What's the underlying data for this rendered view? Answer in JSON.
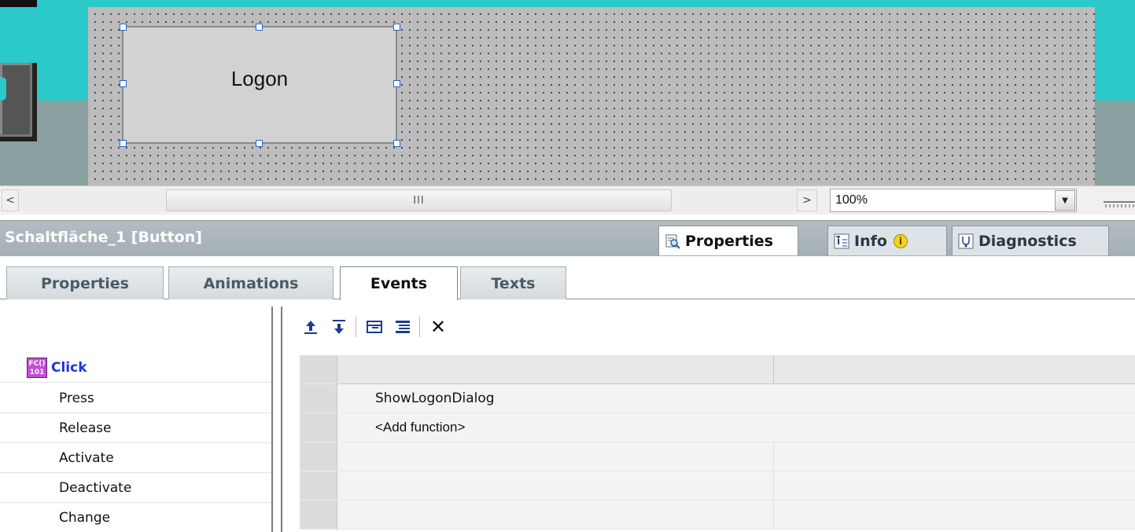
{
  "canvas": {
    "button_text": "Logon"
  },
  "scrollbar": {
    "left_arrow": "<",
    "grip": "III",
    "right_arrow": ">"
  },
  "zoom": {
    "value": "100%",
    "dropdown_arrow": "▼"
  },
  "inspector": {
    "object_title": "Schaltfläche_1 [Button]",
    "top_tabs": [
      {
        "label": "Properties",
        "icon": "properties-icon"
      },
      {
        "label": "Info",
        "icon": "info-icon"
      },
      {
        "label": "Diagnostics",
        "icon": "diagnostics-icon"
      }
    ],
    "info_badge": "i",
    "sub_tabs": [
      "Properties",
      "Animations",
      "Events",
      "Texts"
    ],
    "active_sub_tab": "Events"
  },
  "events": {
    "selected_icon_text": "FC() 101",
    "items": [
      "Click",
      "Press",
      "Release",
      "Activate",
      "Deactivate",
      "Change"
    ]
  },
  "toolbar": {
    "buttons": [
      "move-up-icon",
      "move-down-icon",
      "collapse-icon",
      "expand-icon",
      "delete-icon"
    ],
    "delete_glyph": "✕"
  },
  "functions": {
    "rows": [
      "ShowLogonDialog",
      "<Add function>",
      "",
      "",
      ""
    ]
  },
  "colors": {
    "canvas_bg": "#2bc9c9",
    "grid_bg": "#bdbdbd",
    "inspector_header": "#a9b4ba",
    "selected_event": "#1b35d6",
    "toolbar_icon": "#1a3d8f",
    "info_badge": "#f7d21e"
  }
}
